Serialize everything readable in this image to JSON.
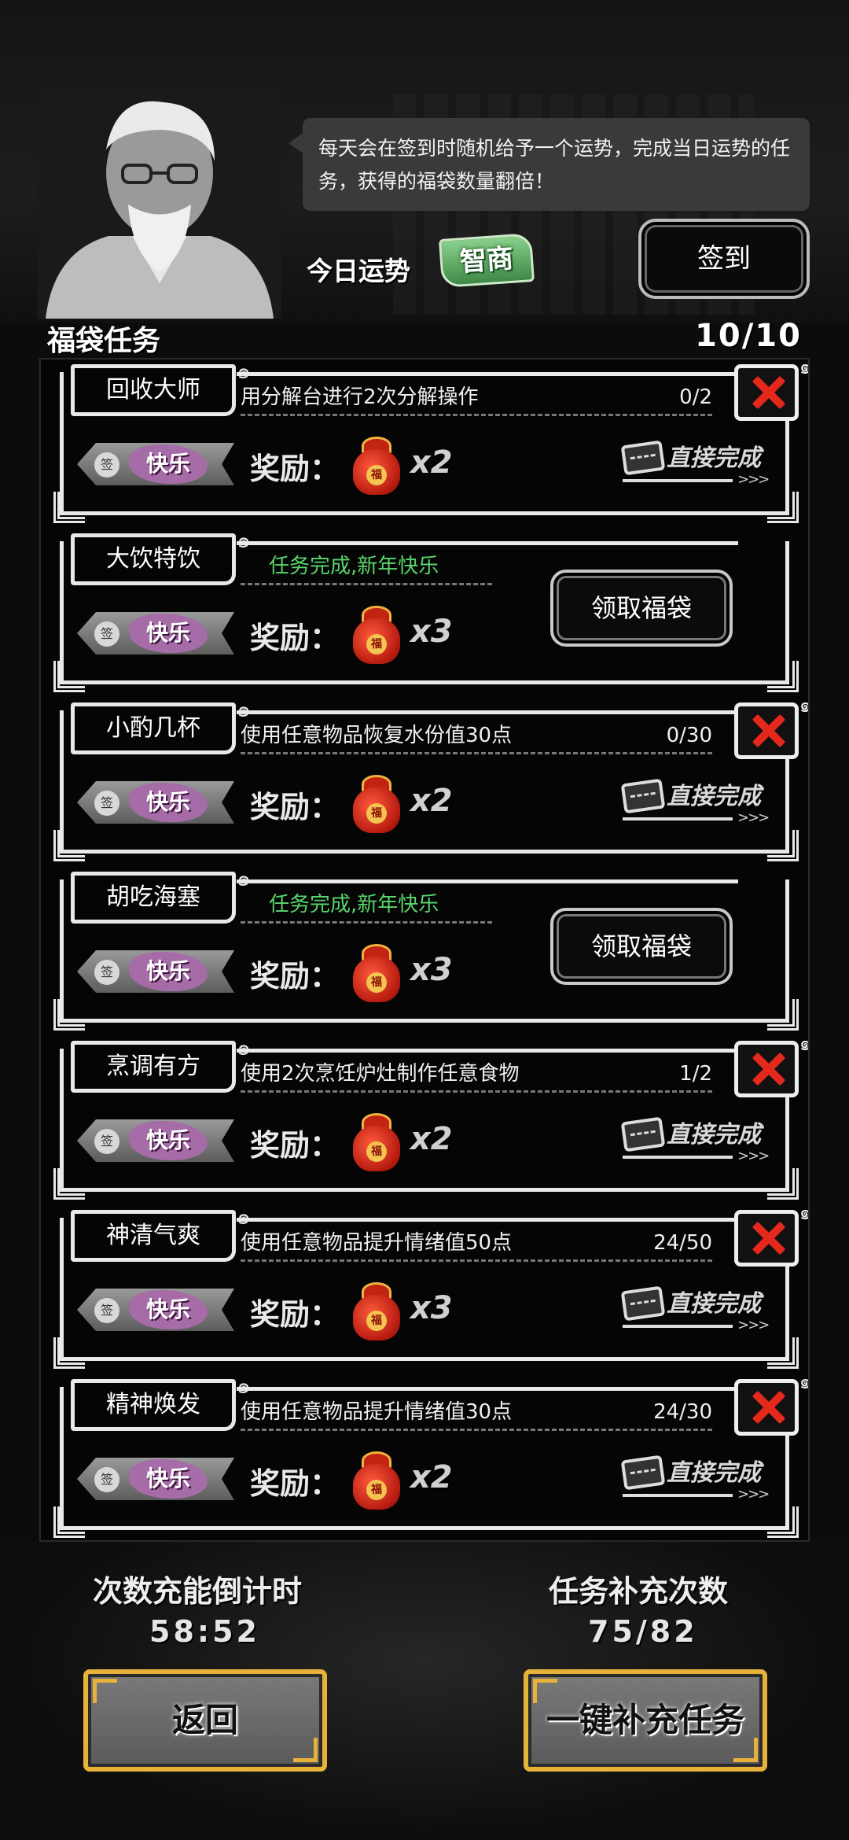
{
  "header": {
    "speech": "每天会在签到时随机给予一个运势，完成当日运势的任务，获得的福袋数量翻倍！",
    "fortune_label": "今日运势",
    "fortune_value": "智商",
    "sign_in_label": "签到"
  },
  "section": {
    "title": "福袋任务",
    "count": "10/10"
  },
  "common": {
    "reward_label": "奖励：",
    "direct_complete": "直接完成",
    "claim_label": "领取福袋",
    "happy": "快乐",
    "sign": "签",
    "bag_char": "福"
  },
  "tasks": [
    {
      "name": "回收大师",
      "desc": "用分解台进行2次分解操作",
      "progress": "0/2",
      "mult": "x2",
      "status": "pending"
    },
    {
      "name": "大饮特饮",
      "desc": "任务完成,新年快乐",
      "progress": "",
      "mult": "x3",
      "status": "done"
    },
    {
      "name": "小酌几杯",
      "desc": "使用任意物品恢复水份值30点",
      "progress": "0/30",
      "mult": "x2",
      "status": "pending"
    },
    {
      "name": "胡吃海塞",
      "desc": "任务完成,新年快乐",
      "progress": "",
      "mult": "x3",
      "status": "done"
    },
    {
      "name": "烹调有方",
      "desc": "使用2次烹饪炉灶制作任意食物",
      "progress": "1/2",
      "mult": "x2",
      "status": "pending"
    },
    {
      "name": "神清气爽",
      "desc": "使用任意物品提升情绪值50点",
      "progress": "24/50",
      "mult": "x3",
      "status": "pending"
    },
    {
      "name": "精神焕发",
      "desc": "使用任意物品提升情绪值30点",
      "progress": "24/30",
      "mult": "x2",
      "status": "pending"
    }
  ],
  "footer": {
    "timer_title": "次数充能倒计时",
    "timer_value": "58:52",
    "refill_title": "任务补充次数",
    "refill_value": "75/82",
    "back_label": "返回",
    "refill_button": "一键补充任务"
  },
  "colors": {
    "done_text": "#59d56b",
    "close_x": "#e5281c",
    "gold_border": "#e6b23a",
    "fortune_badge": "#4f9a57"
  },
  "icons": [
    "close-icon",
    "lucky-bag-icon",
    "ticket-icon",
    "happy-tag-icon"
  ]
}
